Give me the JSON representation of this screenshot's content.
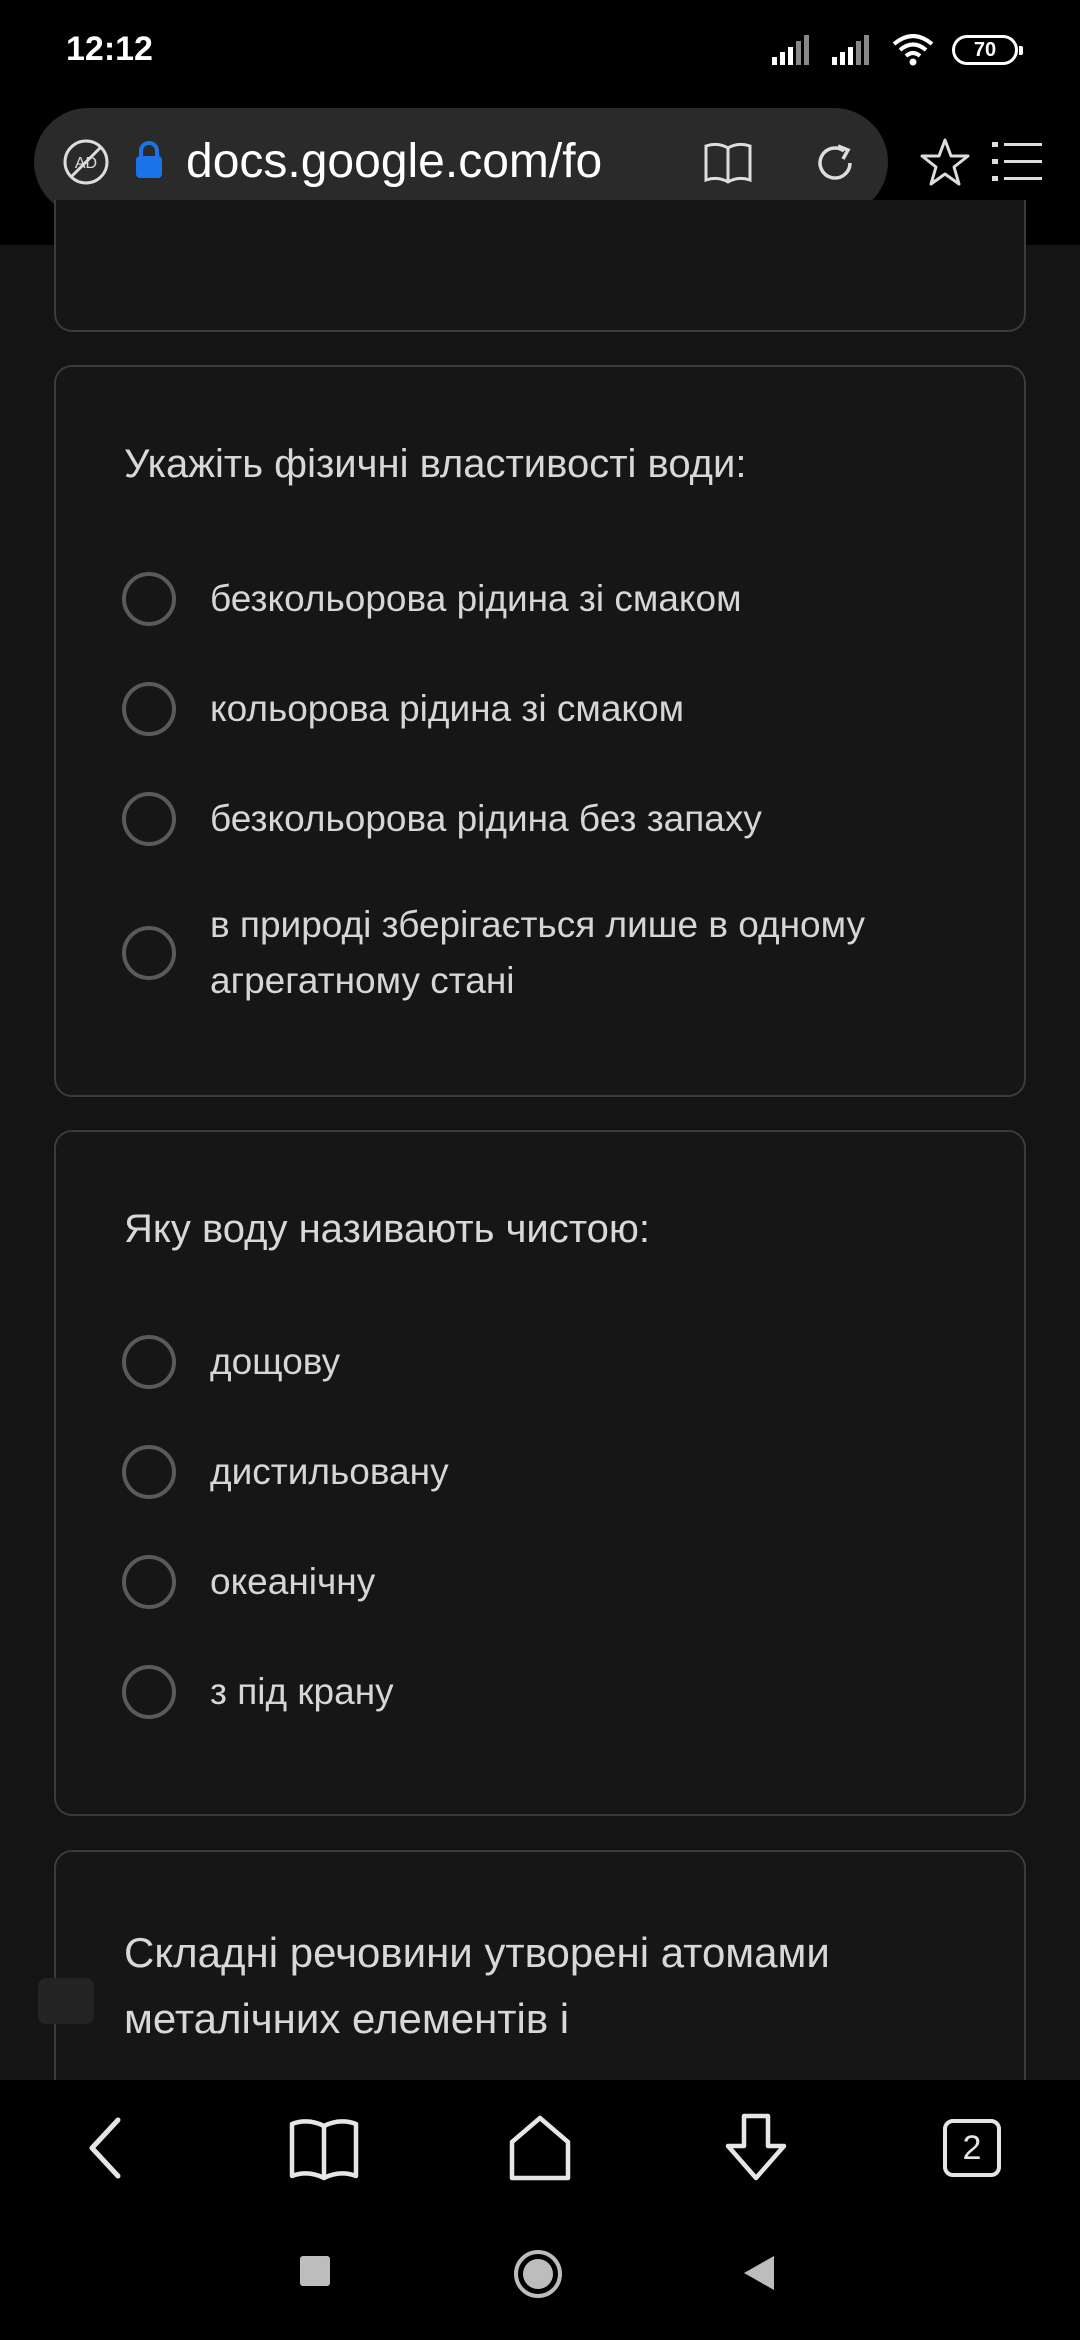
{
  "status_bar": {
    "time": "12:12",
    "battery": "70"
  },
  "browser": {
    "url": "docs.google.com/fo",
    "tabs_count": "2"
  },
  "form": {
    "questions": [
      {
        "title": "Укажіть фізичні властивості води:",
        "options": [
          "безкольорова рідина зі смаком",
          "кольорова рідина зі смаком",
          "безкольорова рідина без запаху",
          "в природі зберігається лише в одному",
          "агрегатному стані"
        ]
      },
      {
        "title": "Яку воду називають чистою:",
        "options": [
          "дощову",
          "дистильовану",
          "океанічну",
          "з під крану"
        ]
      },
      {
        "title_line1": "Складні речовини утворені атомами",
        "title_line2": "металічних елементів і"
      }
    ]
  },
  "colors": {
    "background": "#141414",
    "card_border": "#3b3b3b",
    "lock_blue": "#1a73e8"
  },
  "icons": [
    "adblock-icon",
    "lock-icon",
    "reader-mode-icon",
    "reload-icon",
    "star-icon",
    "menu-icon",
    "back-icon",
    "bookmarks-icon",
    "home-icon",
    "download-icon",
    "tabs-icon",
    "recents-icon",
    "system-home-icon",
    "system-back-icon",
    "signal-icon",
    "wifi-icon",
    "feedback-icon"
  ]
}
